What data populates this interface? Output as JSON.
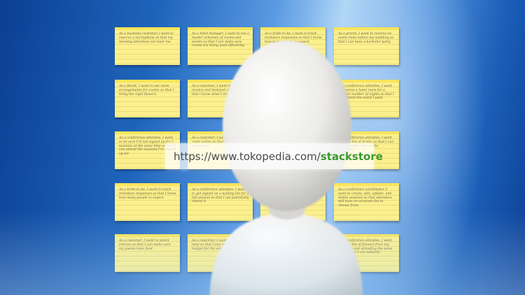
{
  "banner": {
    "icon": "shopping-bag-icon",
    "url_prefix": "https://www.tokopedia.com/",
    "url_path": "stackstore"
  },
  "colors": {
    "background_dark": "#0b3f93",
    "background_light": "#a9d2f5",
    "card_yellow": "#fbf08d",
    "url_green": "#3b9a2d",
    "bag_green": "#42b549"
  },
  "cards": [
    {
      "text": "As a business customer, I want to reserve a microphone so that my meeting attendees can hear me."
    },
    {
      "text": "As a hotel manager, I want to see a master schedule of rooms and events so that I can make sure rooms are being used efficiently."
    },
    {
      "text": "As a bride-to-be, I want to track invitation responses so that I know how many people to expect."
    },
    {
      "text": "As a groom, I want to reserve an event room before my wedding so that I can have a bachelor party."
    },
    {
      "text": "As a florist, I want to see room arrangements for events so that I bring the right flowers."
    },
    {
      "text": "As a customer, I want to see my invoice and itemized charges so that I know what I am paying for."
    },
    {
      "text": "As a caterer, I want to see the number of attendees so that I prepare enough food."
    },
    {
      "text": "As a conference attendee, I want to reserve a hotel room for a specific number of nights so that I can attend the event I paid."
    },
    {
      "text": "As a conference attendee, I want to be sure I'm not signed up for 2 sessions at the same time so that I can attend the sessions I've signed up for."
    },
    {
      "text": "As a customer, I want to book a room online so that I can reserve it any time."
    },
    {
      "text": "As a speaker, I want to upload my slides so that attendees can review them."
    },
    {
      "text": "As a conference attendee, I want to see a list of drinks so that I can choose what I like at the reception."
    },
    {
      "text": "As a bride-to-be, I want to track invitation responses so that I know how many people to expect."
    },
    {
      "text": "As a conference attendee, I want to get signed on a waiting list for a full session so that I am potentially attend it."
    },
    {
      "text": "As a hotel guest, I want to book a spa appointment so that I can relax."
    },
    {
      "text": "As a conference coordinator, I want to create, edit, update, and delete sessions so that attendees will have an accurate list to choose from."
    },
    {
      "text": "As a customer, I want to select entrees so that I can make sure my guests have food."
    },
    {
      "text": "As a customer, I want to see my total so that I can stay within my budget for the entire event."
    },
    {
      "text": "As a manager, I want to see revenue reports so that I can plan next year."
    },
    {
      "text": "As a conference attendee, I want to see a list of dinners from my company and attending the same sessions so I can network."
    }
  ]
}
